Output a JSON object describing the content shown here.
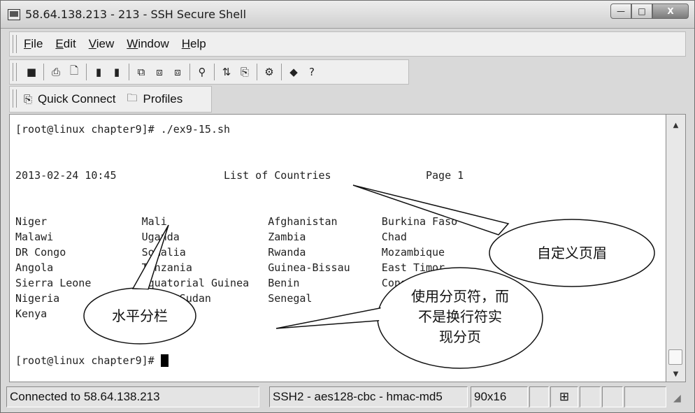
{
  "window": {
    "title": "58.64.138.213 - 213 - SSH Secure Shell",
    "buttons": {
      "minimize": "—",
      "maximize": "□",
      "close": "X"
    }
  },
  "menu": [
    {
      "hot": "F",
      "rest": "ile"
    },
    {
      "hot": "E",
      "rest": "dit"
    },
    {
      "hot": "V",
      "rest": "iew"
    },
    {
      "hot": "W",
      "rest": "indow"
    },
    {
      "hot": "H",
      "rest": "elp"
    }
  ],
  "toolbar": {
    "icons": [
      "save-icon",
      "print-icon",
      "print-preview-icon",
      "connect-icon",
      "disconnect-icon",
      "copy-icon",
      "paste-icon",
      "paste-alt-icon",
      "find-icon",
      "file-transfer-icon",
      "new-window-icon",
      "settings-icon",
      "help-book-icon",
      "context-help-icon"
    ],
    "glyphs": [
      "■",
      "⎙",
      "🗋",
      "▮",
      "▮",
      "⧉",
      "⧈",
      "⧈",
      "⚲",
      "⇅",
      "⎘",
      "⚙",
      "◆",
      "?"
    ]
  },
  "quickbar": {
    "quick_connect": "Quick Connect",
    "profiles": "Profiles"
  },
  "terminal": {
    "lines": [
      "[root@linux chapter9]# ./ex9-15.sh",
      "",
      "",
      "2013-02-24 10:45                 List of Countries               Page 1",
      "",
      "",
      "Niger               Mali                Afghanistan       Burkina Faso",
      "Malawi              Uganda              Zambia            Chad",
      "DR Congo            Somalia             Rwanda            Mozambique",
      "Angola              Tanzania            Guinea-Bissau     East Timor",
      "Sierra Leone        Equatorial Guinea   Benin             Congo",
      "Nigeria             South Sudan         Senegal",
      "Kenya",
      "",
      "",
      "[root@linux chapter9]# "
    ]
  },
  "statusbar": {
    "connection": "Connected to 58.64.138.213",
    "cipher": "SSH2 - aes128-cbc - hmac-md5",
    "size": "90x16"
  },
  "annotations": {
    "header": "自定义页眉",
    "columns": "水平分栏",
    "pagebreak": "使用分页符，而不是换行符实现分页",
    "pagebreak_lines": [
      "使用分页符，而",
      "不是换行符实",
      "现分页"
    ]
  }
}
